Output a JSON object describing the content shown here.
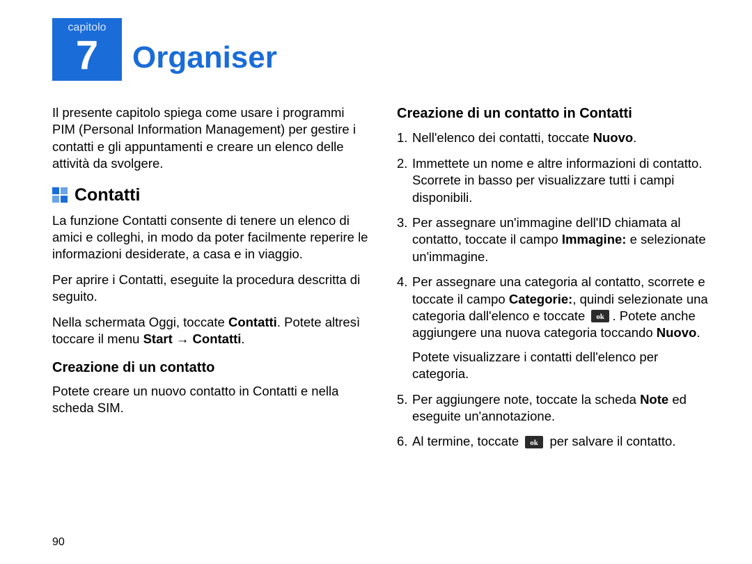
{
  "chapter": {
    "label": "capitolo",
    "number": "7",
    "title": "Organiser"
  },
  "left": {
    "intro": "Il presente capitolo spiega come usare i programmi PIM (Personal Information Management) per gestire i contatti e gli appuntamenti e creare un elenco delle attività da svolgere.",
    "section_title": "Contatti",
    "p1": "La funzione Contatti consente di tenere un elenco di amici e colleghi, in modo da poter facilmente reperire le informazioni desiderate, a casa e in viaggio.",
    "p2": "Per aprire i Contatti, eseguite la procedura descritta di seguito.",
    "p3_pre": "Nella schermata Oggi, toccate ",
    "p3_b1": "Contatti",
    "p3_mid": ". Potete altresì toccare il menu ",
    "p3_b2": "Start",
    "p3_arrow": " → ",
    "p3_b3": "Contatti",
    "p3_post": ".",
    "sub_head": "Creazione di un contatto",
    "p4": "Potete creare un nuovo contatto in Contatti e nella scheda SIM."
  },
  "right": {
    "head": "Creazione di un contatto in Contatti",
    "s1_pre": "Nell'elenco dei contatti, toccate ",
    "s1_b": "Nuovo",
    "s1_post": ".",
    "s2": "Immettete un nome e altre informazioni di contatto. Scorrete in basso per visualizzare tutti i campi disponibili.",
    "s3_pre": "Per assegnare un'immagine dell'ID chiamata al contatto, toccate il campo ",
    "s3_b": "Immagine:",
    "s3_post": " e selezionate un'immagine.",
    "s4_pre": "Per assegnare una categoria al contatto, scorrete e toccate il campo ",
    "s4_b1": "Categorie:",
    "s4_mid1": ", quindi selezionate una categoria dall'elenco e toccate ",
    "s4_mid2": ". Potete anche aggiungere una nuova categoria toccando ",
    "s4_b2": "Nuovo",
    "s4_end": ".",
    "s4_extra": "Potete visualizzare i contatti dell'elenco per categoria.",
    "s5_pre": "Per aggiungere note, toccate la scheda ",
    "s5_b": "Note",
    "s5_post": " ed eseguite un'annotazione.",
    "s6_pre": "Al termine, toccate ",
    "s6_post": " per salvare il contatto."
  },
  "page_number": "90"
}
